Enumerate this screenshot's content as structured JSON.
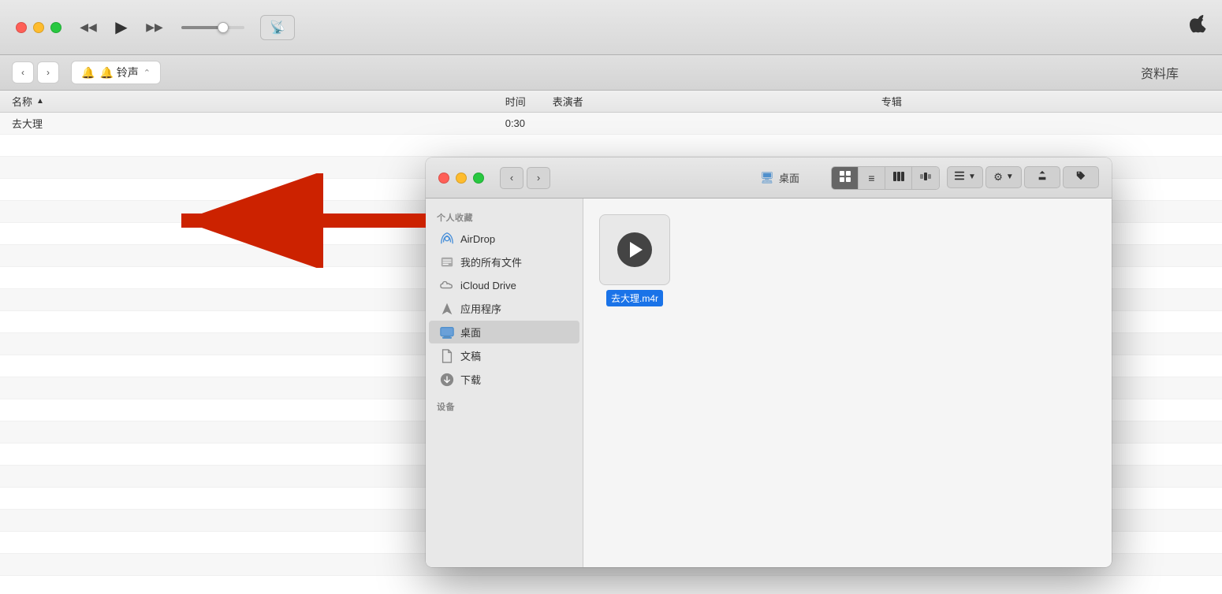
{
  "itunes": {
    "toolbar": {
      "rewind_label": "⏮",
      "play_label": "▶",
      "forward_label": "⏭",
      "airplay_label": "⊕"
    },
    "navbar": {
      "ringtone_label": "🔔 铃声",
      "library_label": "资料库"
    },
    "table": {
      "columns": {
        "name": "名称",
        "sort_icon": "▲",
        "time": "时间",
        "artist": "表演者",
        "album": "专辑"
      },
      "rows": [
        {
          "name": "去大理",
          "time": "0:30",
          "artist": "",
          "album": ""
        },
        {
          "name": "",
          "time": "",
          "artist": "",
          "album": ""
        },
        {
          "name": "",
          "time": "",
          "artist": "",
          "album": ""
        },
        {
          "name": "",
          "time": "",
          "artist": "",
          "album": ""
        },
        {
          "name": "",
          "time": "",
          "artist": "",
          "album": ""
        },
        {
          "name": "",
          "time": "",
          "artist": "",
          "album": ""
        },
        {
          "name": "",
          "time": "",
          "artist": "",
          "album": ""
        },
        {
          "name": "",
          "time": "",
          "artist": "",
          "album": ""
        },
        {
          "name": "",
          "time": "",
          "artist": "",
          "album": ""
        },
        {
          "name": "",
          "time": "",
          "artist": "",
          "album": ""
        },
        {
          "name": "",
          "time": "",
          "artist": "",
          "album": ""
        },
        {
          "name": "",
          "time": "",
          "artist": "",
          "album": ""
        },
        {
          "name": "",
          "time": "",
          "artist": "",
          "album": ""
        },
        {
          "name": "",
          "time": "",
          "artist": "",
          "album": ""
        },
        {
          "name": "",
          "time": "",
          "artist": "",
          "album": ""
        },
        {
          "name": "",
          "time": "",
          "artist": "",
          "album": ""
        },
        {
          "name": "",
          "time": "",
          "artist": "",
          "album": ""
        },
        {
          "name": "",
          "time": "",
          "artist": "",
          "album": ""
        }
      ]
    }
  },
  "finder": {
    "window_title": "桌面",
    "desktop_badge": "🖥 桌面",
    "nav": {
      "back": "‹",
      "forward": "›"
    },
    "view_buttons": {
      "icon": "⊞",
      "list": "≡",
      "column": "⊟",
      "cover": "⊠",
      "group": "⊞",
      "action": "⚙",
      "share": "↑",
      "tag": "🏷"
    },
    "sidebar": {
      "favorites_label": "个人收藏",
      "items": [
        {
          "id": "airdrop",
          "icon": "📡",
          "label": "AirDrop"
        },
        {
          "id": "all-files",
          "icon": "🗃",
          "label": "我的所有文件"
        },
        {
          "id": "icloud",
          "icon": "☁",
          "label": "iCloud Drive"
        },
        {
          "id": "applications",
          "icon": "🚀",
          "label": "应用程序"
        },
        {
          "id": "desktop",
          "icon": "🖥",
          "label": "桌面"
        },
        {
          "id": "documents",
          "icon": "📄",
          "label": "文稿"
        },
        {
          "id": "downloads",
          "icon": "⬇",
          "label": "下载"
        },
        {
          "id": "devices",
          "icon": "",
          "label": "设备"
        }
      ]
    },
    "file": {
      "icon_label": "去大理.m4r",
      "name": "去大理.m4r"
    }
  }
}
